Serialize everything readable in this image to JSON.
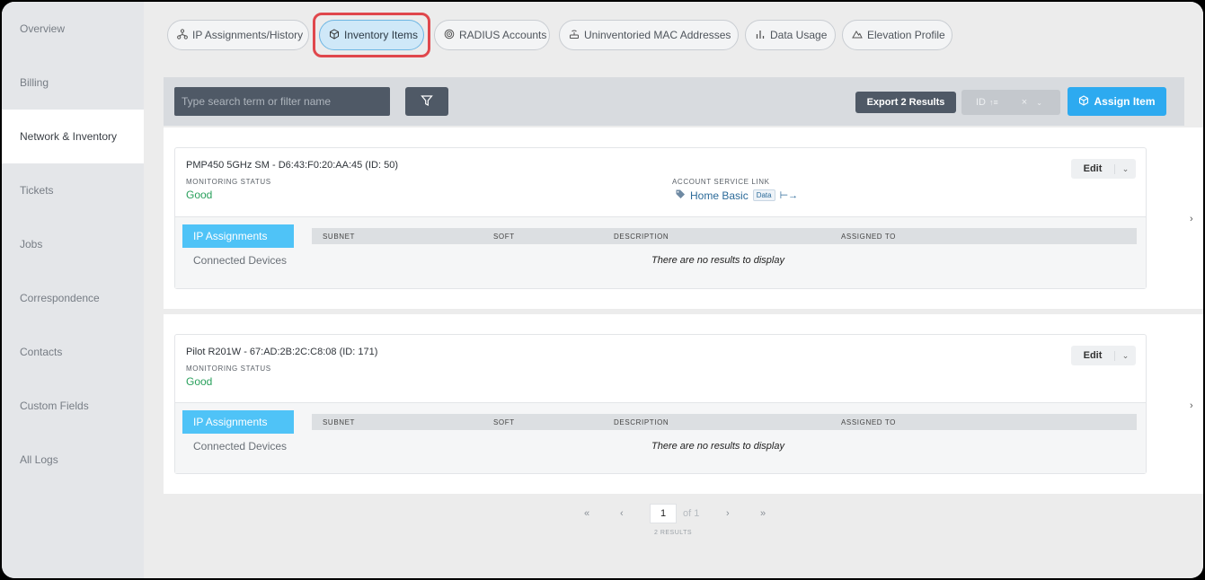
{
  "sidebar": {
    "items": [
      {
        "label": "Overview"
      },
      {
        "label": "Billing"
      },
      {
        "label": "Network & Inventory"
      },
      {
        "label": "Tickets"
      },
      {
        "label": "Jobs"
      },
      {
        "label": "Correspondence"
      },
      {
        "label": "Contacts"
      },
      {
        "label": "Custom Fields"
      },
      {
        "label": "All Logs"
      }
    ],
    "active": "Network & Inventory"
  },
  "tabs": [
    {
      "label": "IP Assignments/History",
      "icon": "network-icon"
    },
    {
      "label": "Inventory Items",
      "icon": "cube-icon",
      "active": true
    },
    {
      "label": "RADIUS Accounts",
      "icon": "target-icon"
    },
    {
      "label": "Uninventoried MAC Addresses",
      "icon": "router-icon"
    },
    {
      "label": "Data Usage",
      "icon": "bar-chart-icon"
    },
    {
      "label": "Elevation Profile",
      "icon": "mountain-icon"
    }
  ],
  "toolbar": {
    "search_placeholder": "Type search term or filter name",
    "export_label": "Export 2 Results",
    "sort_label": "ID",
    "assign_label": "Assign Item"
  },
  "items": [
    {
      "title": "PMP450 5GHz SM - D6:43:F0:20:AA:45 (ID: 50)",
      "monitoring_label": "MONITORING STATUS",
      "monitoring_value": "Good",
      "service_link_label": "ACCOUNT SERVICE LINK",
      "service_link_value": "Home Basic",
      "service_link_badge": "Data",
      "edit_label": "Edit",
      "tabs": [
        "IP Assignments",
        "Connected Devices"
      ],
      "columns": [
        "SUBNET",
        "SOFT",
        "DESCRIPTION",
        "ASSIGNED TO"
      ],
      "empty_text": "There are no results to display"
    },
    {
      "title": "Pilot R201W - 67:AD:2B:2C:C8:08 (ID: 171)",
      "monitoring_label": "MONITORING STATUS",
      "monitoring_value": "Good",
      "edit_label": "Edit",
      "tabs": [
        "IP Assignments",
        "Connected Devices"
      ],
      "columns": [
        "SUBNET",
        "SOFT",
        "DESCRIPTION",
        "ASSIGNED TO"
      ],
      "empty_text": "There are no results to display"
    }
  ],
  "pagination": {
    "first": "«",
    "prev": "‹",
    "page": "1",
    "of_total": "of 1",
    "next": "›",
    "last": "»",
    "results": "2 RESULTS"
  },
  "colors": {
    "accent": "#2daaf0",
    "status_good": "#29a05c",
    "highlight": "#e0474c"
  }
}
